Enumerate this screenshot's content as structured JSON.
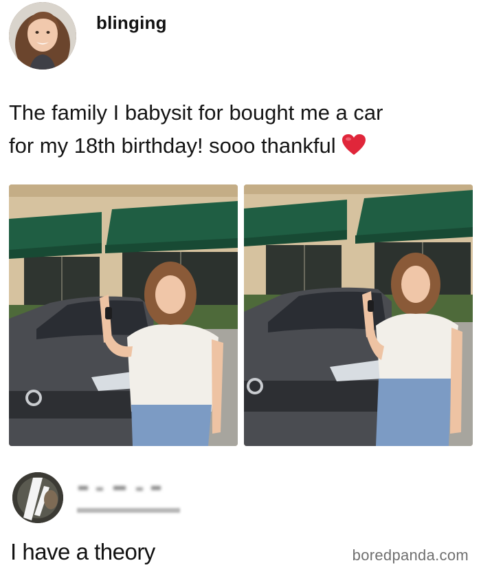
{
  "post": {
    "username": "blinging",
    "text_line1": "The family I babysit for bought me a car",
    "text_line2": "for my 18th birthday! sooo thankful",
    "emoji": "red-heart"
  },
  "photos": [
    {
      "content": "young woman holding car key in front of grey Toyota sedan"
    },
    {
      "content": "young woman holding car key in front of grey Toyota sedan"
    }
  ],
  "reply": {
    "text": "I have a theory"
  },
  "watermark": {
    "text": "boredpanda.com"
  },
  "colors": {
    "awning": "#1f5e43",
    "wall": "#d6c29f",
    "car": "#4a4c51",
    "heart": "#e0263a",
    "watermark": "#6f6f6f"
  }
}
